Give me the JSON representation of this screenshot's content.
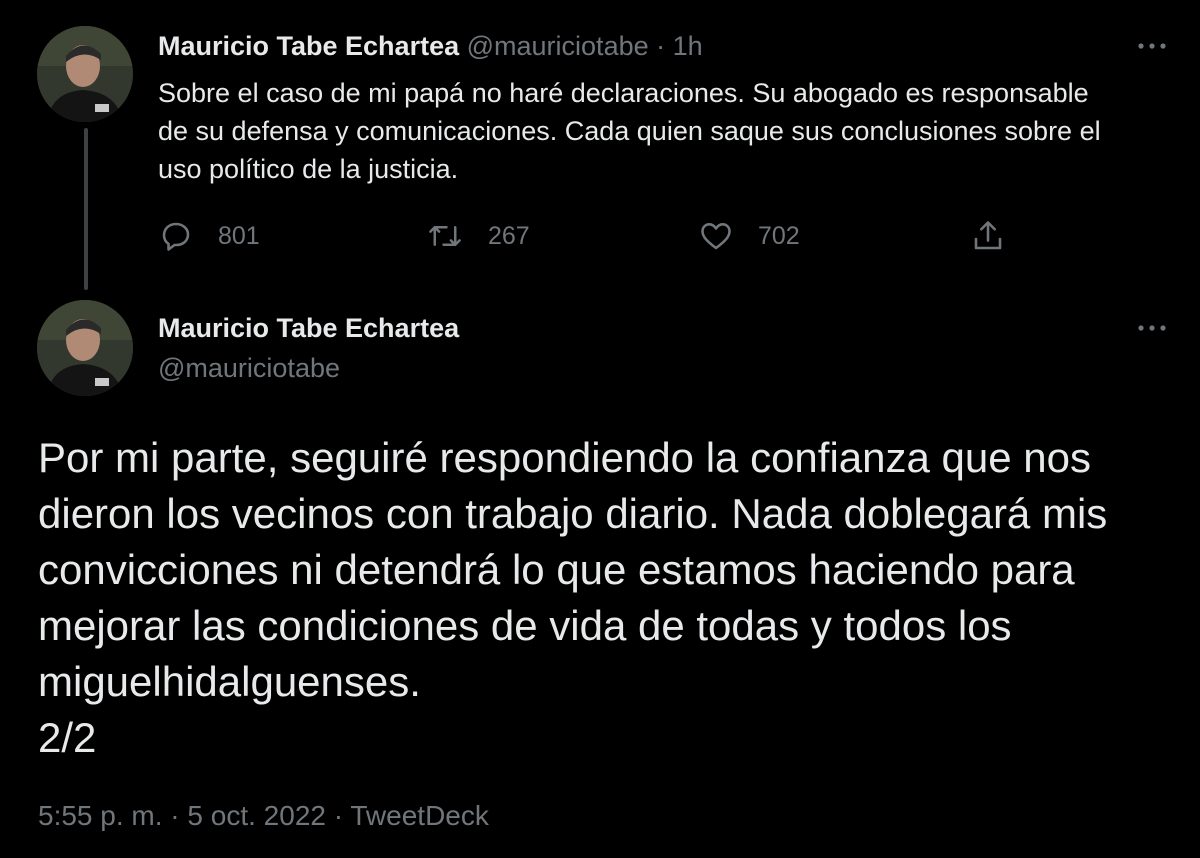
{
  "colors": {
    "background": "#000000",
    "text": "#e7e9ea",
    "muted": "#71767b",
    "thread_line": "#3d4144"
  },
  "tweet1": {
    "avatar_icon": "profile-photo",
    "name": "Mauricio Tabe Echartea",
    "handle": "@mauriciotabe",
    "separator": "·",
    "time": "1h",
    "more_icon": "more-horizontal-icon",
    "text": "Sobre el caso de mi papá no haré declaraciones. Su abogado es responsable de su defensa y comunicaciones. Cada quien saque sus conclusiones sobre el uso político de la justicia.",
    "actions": {
      "replies": "801",
      "retweets": "267",
      "likes": "702",
      "reply_icon": "reply-icon",
      "retweet_icon": "retweet-icon",
      "like_icon": "heart-icon",
      "share_icon": "share-icon"
    }
  },
  "tweet2": {
    "avatar_icon": "profile-photo",
    "name": "Mauricio Tabe Echartea",
    "handle": "@mauriciotabe",
    "more_icon": "more-horizontal-icon",
    "text": "Por mi parte, seguiré respondiendo la confianza que nos dieron los vecinos con trabajo diario. Nada doblegará mis convicciones ni detendrá lo que estamos haciendo para mejorar las condiciones de vida de todas y todos los miguelhidalguenses.",
    "thread_count": "2/2",
    "timestamp": "5:55 p. m.",
    "date": "5 oct. 2022",
    "source": "TweetDeck",
    "separator": "·"
  }
}
